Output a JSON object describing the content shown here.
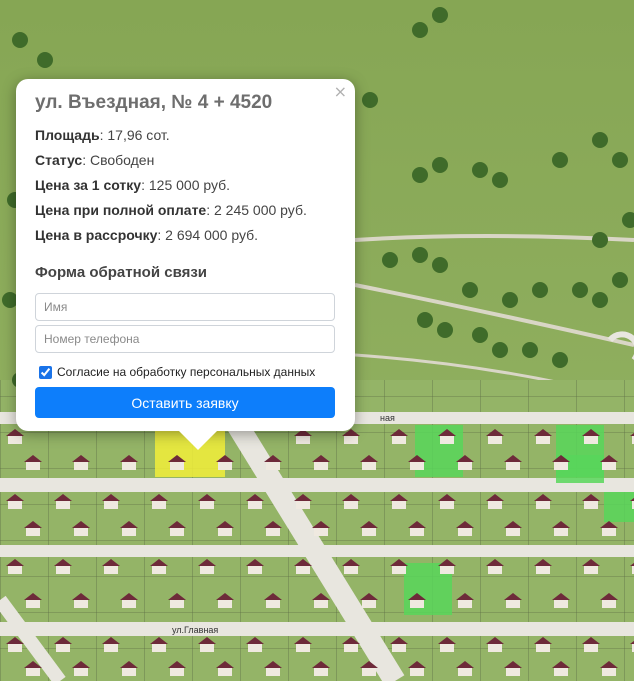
{
  "popup": {
    "title": "ул. Въездная, № 4 + 4520",
    "close_symbol": "×",
    "details": [
      {
        "label": "Площадь",
        "value": ": 17,96 сот."
      },
      {
        "label": "Статус",
        "value": ": Свободен"
      },
      {
        "label": "Цена за 1 сотку",
        "value": ": 125 000 руб."
      },
      {
        "label": "Цена при полной оплате",
        "value": ": 2 245 000 руб."
      },
      {
        "label": "Цена в рассрочку",
        "value": ": 2 694 000 руб."
      }
    ]
  },
  "form": {
    "title": "Форма обратной связи",
    "name_placeholder": "Имя",
    "phone_placeholder": "Номер телефона",
    "consent_label": "Согласие на обработку персональных данных",
    "consent_checked": true,
    "submit_label": "Оставить заявку"
  },
  "map": {
    "street_labels": {
      "main": "ул.Главная",
      "top": "ная"
    },
    "colors": {
      "grass": "#8fae5f",
      "road": "#e8e6df",
      "plot_selected": "#f2ee3a",
      "plot_free": "#58d65a",
      "roof": "#6e2a3a"
    }
  }
}
